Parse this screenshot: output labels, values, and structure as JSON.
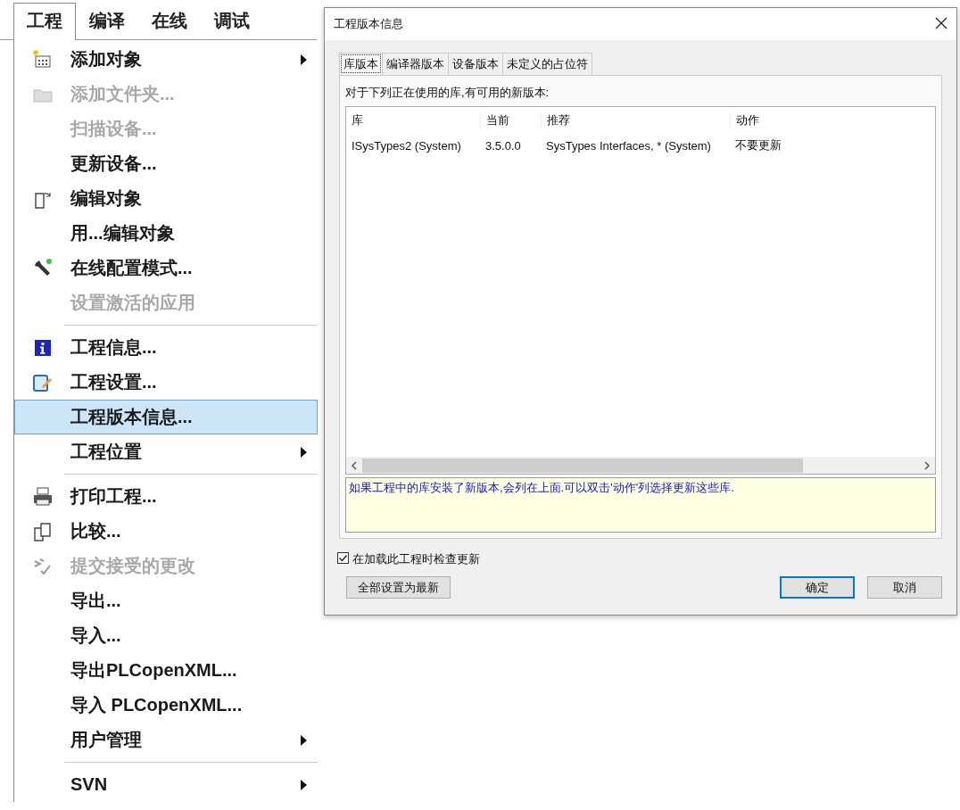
{
  "menu_bar": [
    {
      "label": "工程",
      "selected": true
    },
    {
      "label": "编译",
      "selected": false
    },
    {
      "label": "在线",
      "selected": false
    },
    {
      "label": "调试",
      "selected": false
    }
  ],
  "menu": {
    "groups": [
      [
        {
          "label": "添加对象",
          "disabled": false,
          "submenu": true,
          "selected": false
        },
        {
          "label": "添加文件夹...",
          "disabled": true,
          "submenu": false,
          "selected": false
        },
        {
          "label": "扫描设备...",
          "disabled": true,
          "submenu": false,
          "selected": false
        },
        {
          "label": "更新设备...",
          "disabled": false,
          "submenu": false,
          "selected": false
        },
        {
          "label": "编辑对象",
          "disabled": false,
          "submenu": false,
          "selected": false
        },
        {
          "label": "用...编辑对象",
          "disabled": false,
          "submenu": false,
          "selected": false
        },
        {
          "label": "在线配置模式...",
          "disabled": false,
          "submenu": false,
          "selected": false
        },
        {
          "label": "设置激活的应用",
          "disabled": true,
          "submenu": false,
          "selected": false
        }
      ],
      [
        {
          "label": "工程信息...",
          "disabled": false,
          "submenu": false,
          "selected": false
        },
        {
          "label": "工程设置...",
          "disabled": false,
          "submenu": false,
          "selected": false
        },
        {
          "label": "工程版本信息...",
          "disabled": false,
          "submenu": false,
          "selected": true
        },
        {
          "label": "工程位置",
          "disabled": false,
          "submenu": true,
          "selected": false
        }
      ],
      [
        {
          "label": "打印工程...",
          "disabled": false,
          "submenu": false,
          "selected": false
        },
        {
          "label": "比较...",
          "disabled": false,
          "submenu": false,
          "selected": false
        },
        {
          "label": "提交接受的更改",
          "disabled": true,
          "submenu": false,
          "selected": false
        },
        {
          "label": "导出...",
          "disabled": false,
          "submenu": false,
          "selected": false
        },
        {
          "label": "导入...",
          "disabled": false,
          "submenu": false,
          "selected": false
        },
        {
          "label": "导出PLCopenXML...",
          "disabled": false,
          "submenu": false,
          "selected": false
        },
        {
          "label": "导入 PLCopenXML...",
          "disabled": false,
          "submenu": false,
          "selected": false
        },
        {
          "label": "用户管理",
          "disabled": false,
          "submenu": true,
          "selected": false
        }
      ],
      [
        {
          "label": "SVN",
          "disabled": false,
          "submenu": true,
          "selected": false
        }
      ]
    ]
  },
  "dialog": {
    "title": "工程版本信息",
    "tabs": [
      {
        "label": "库版本",
        "selected": true
      },
      {
        "label": "编译器版本",
        "selected": false
      },
      {
        "label": "设备版本",
        "selected": false
      },
      {
        "label": "未定义的占位符",
        "selected": false
      }
    ],
    "intro": "对于下列正在使用的库,有可用的新版本:",
    "table": {
      "columns": [
        "库",
        "当前",
        "推荐",
        "动作"
      ],
      "rows": [
        [
          "ISysTypes2 (System)",
          "3.5.0.0",
          "SysTypes Interfaces, * (System)",
          "不要更新"
        ]
      ]
    },
    "hint": "如果工程中的库安装了新版本,会列在上面.可以双击'动作'列选择更新这些库.",
    "check_on_load": {
      "label": "在加载此工程时检查更新",
      "checked": true
    },
    "buttons": [
      {
        "label": "全部设置为最新",
        "default": false
      },
      {
        "label": "确定",
        "default": true
      },
      {
        "label": "取消",
        "default": false
      }
    ]
  }
}
